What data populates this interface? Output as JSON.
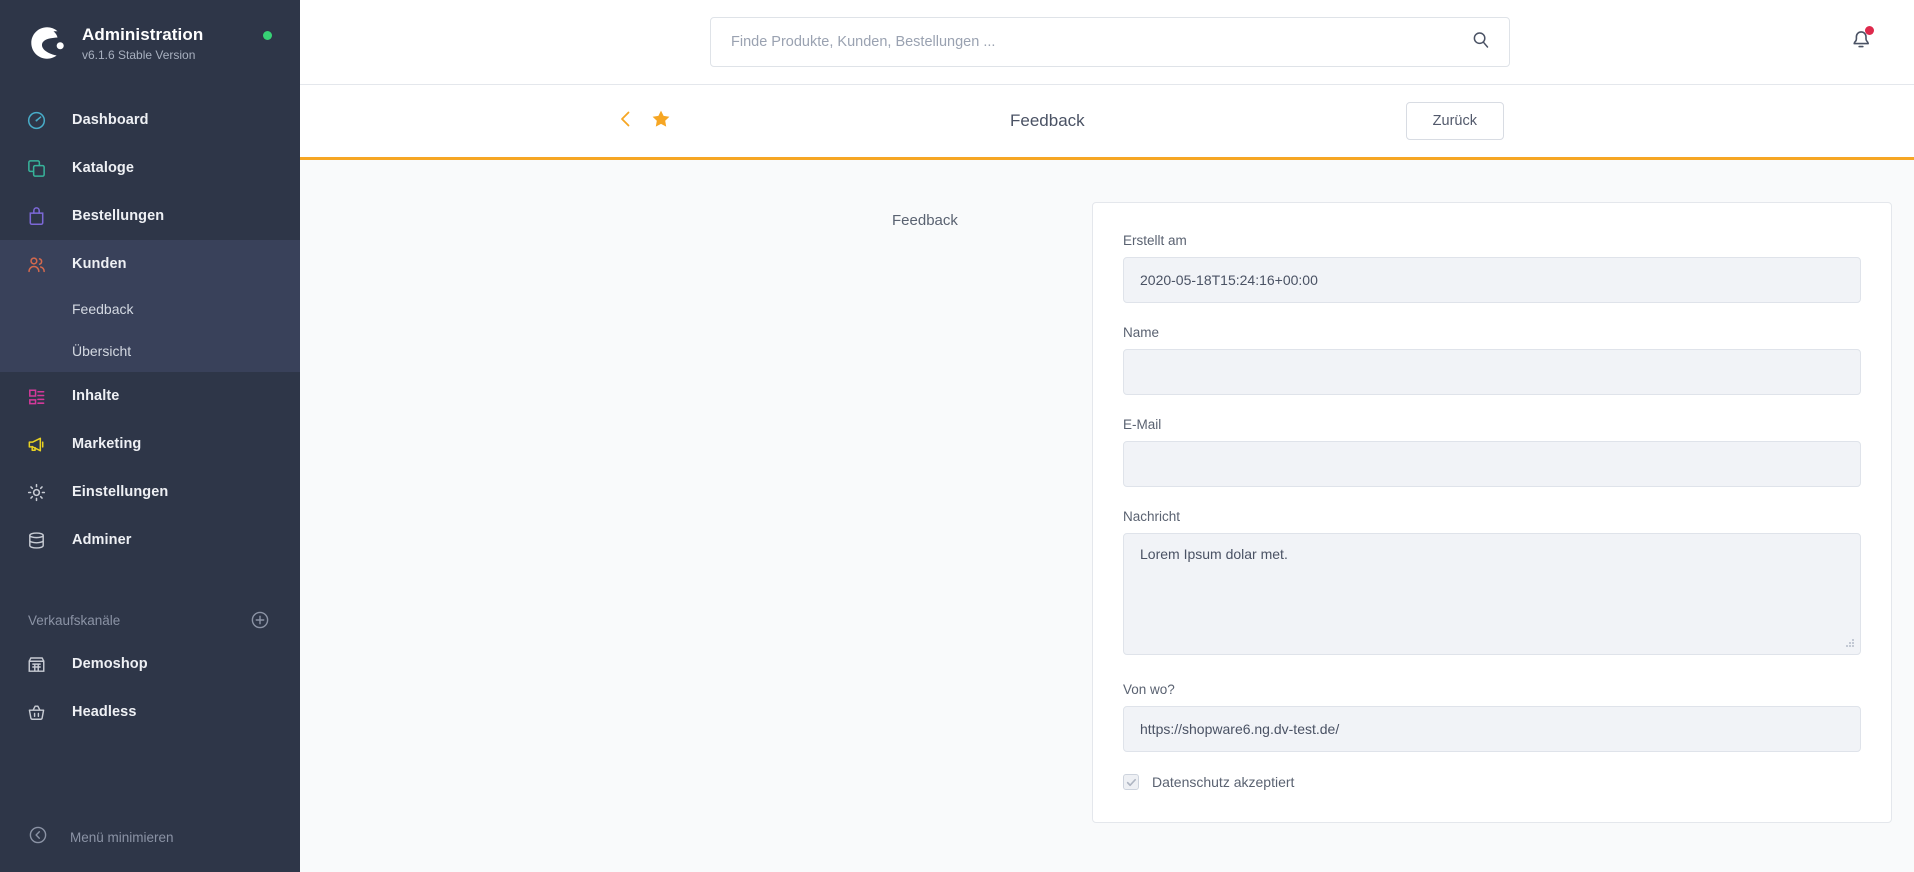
{
  "sidebar": {
    "brand": {
      "title": "Administration",
      "version": "v6.1.6 Stable Version"
    },
    "items": [
      {
        "label": "Dashboard",
        "icon": "gauge-icon",
        "color": "#48acc8"
      },
      {
        "label": "Kataloge",
        "icon": "copy-icon",
        "color": "#37b39a"
      },
      {
        "label": "Bestellungen",
        "icon": "bag-icon",
        "color": "#7c68d6"
      },
      {
        "label": "Kunden",
        "icon": "users-icon",
        "color": "#d4694d",
        "active": true
      },
      {
        "label": "Inhalte",
        "icon": "content-icon",
        "color": "#d4399a"
      },
      {
        "label": "Marketing",
        "icon": "megaphone-icon",
        "color": "#e8d122"
      },
      {
        "label": "Einstellungen",
        "icon": "gear-icon",
        "color": "#c8ccd4"
      },
      {
        "label": "Adminer",
        "icon": "database-icon",
        "color": "#c8ccd4"
      }
    ],
    "sub_items": [
      {
        "label": "Feedback"
      },
      {
        "label": "Übersicht"
      }
    ],
    "section": {
      "title": "Verkaufskanäle",
      "add_icon": "plus-circle-icon"
    },
    "channels": [
      {
        "label": "Demoshop",
        "icon": "storefront-icon"
      },
      {
        "label": "Headless",
        "icon": "basket-icon"
      }
    ],
    "footer": {
      "label": "Menü minimieren",
      "icon": "collapse-left-icon"
    },
    "status_indicator": "online-dot"
  },
  "topbar": {
    "search": {
      "placeholder": "Finde Produkte, Kunden, Bestellungen ...",
      "value": "",
      "icon": "search-icon"
    },
    "notifications": {
      "icon": "bell-icon",
      "badge": "unread-dot"
    }
  },
  "pagehead": {
    "back_icon": "chevron-left-icon",
    "favorite_icon": "star-icon",
    "title": "Feedback",
    "back_button": "Zurück"
  },
  "form": {
    "card_label": "Feedback",
    "fields": {
      "created_at": {
        "label": "Erstellt am",
        "value": "2020-05-18T15:24:16+00:00"
      },
      "name": {
        "label": "Name",
        "value": ""
      },
      "email": {
        "label": "E-Mail",
        "value": ""
      },
      "message": {
        "label": "Nachricht",
        "value": "Lorem Ipsum dolar met."
      },
      "origin": {
        "label": "Von wo?",
        "value": "https://shopware6.ng.dv-test.de/"
      },
      "privacy": {
        "label": "Datenschutz akzeptiert",
        "checked": true
      }
    }
  },
  "colors": {
    "sidebar_bg": "#2e3648",
    "sidebar_active": "#39415a",
    "accent_orange": "#f6a623",
    "notification_red": "#de294c",
    "status_green": "#37d275"
  }
}
